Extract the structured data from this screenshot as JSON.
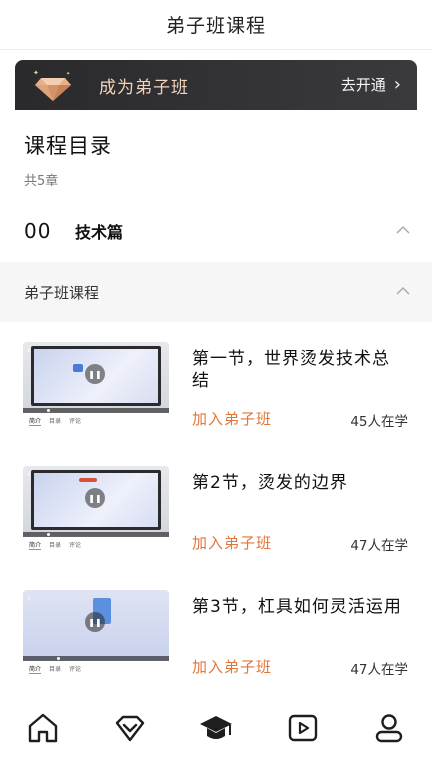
{
  "header": {
    "title": "弟子班课程"
  },
  "banner": {
    "text": "成为弟子班",
    "action": "去开通",
    "chevron": "›"
  },
  "catalog": {
    "title": "课程目录",
    "count": "共5章"
  },
  "chapter": {
    "number": "00",
    "name": "技术篇"
  },
  "section": {
    "name": "弟子班课程"
  },
  "lessons": [
    {
      "title": "第一节，世界烫发技术总结",
      "join": "加入弟子班",
      "learners": "45人在学",
      "thumb_tabs": [
        "简介",
        "目录",
        "评论"
      ]
    },
    {
      "title": "第2节，烫发的边界",
      "join": "加入弟子班",
      "learners": "47人在学",
      "thumb_tabs": [
        "简介",
        "目录",
        "评论"
      ]
    },
    {
      "title": "第3节，杠具如何灵活运用",
      "join": "加入弟子班",
      "learners": "47人在学",
      "thumb_tabs": [
        "简介",
        "目录",
        "评论"
      ]
    }
  ],
  "tabbar": {
    "items": [
      {
        "icon": "home-icon"
      },
      {
        "icon": "diamond-icon"
      },
      {
        "icon": "graduation-cap-icon"
      },
      {
        "icon": "video-play-icon"
      },
      {
        "icon": "user-icon"
      }
    ]
  },
  "colors": {
    "accent": "#e0763a",
    "banner_bg": "#2f2f31",
    "banner_text": "#f1d4ba"
  }
}
